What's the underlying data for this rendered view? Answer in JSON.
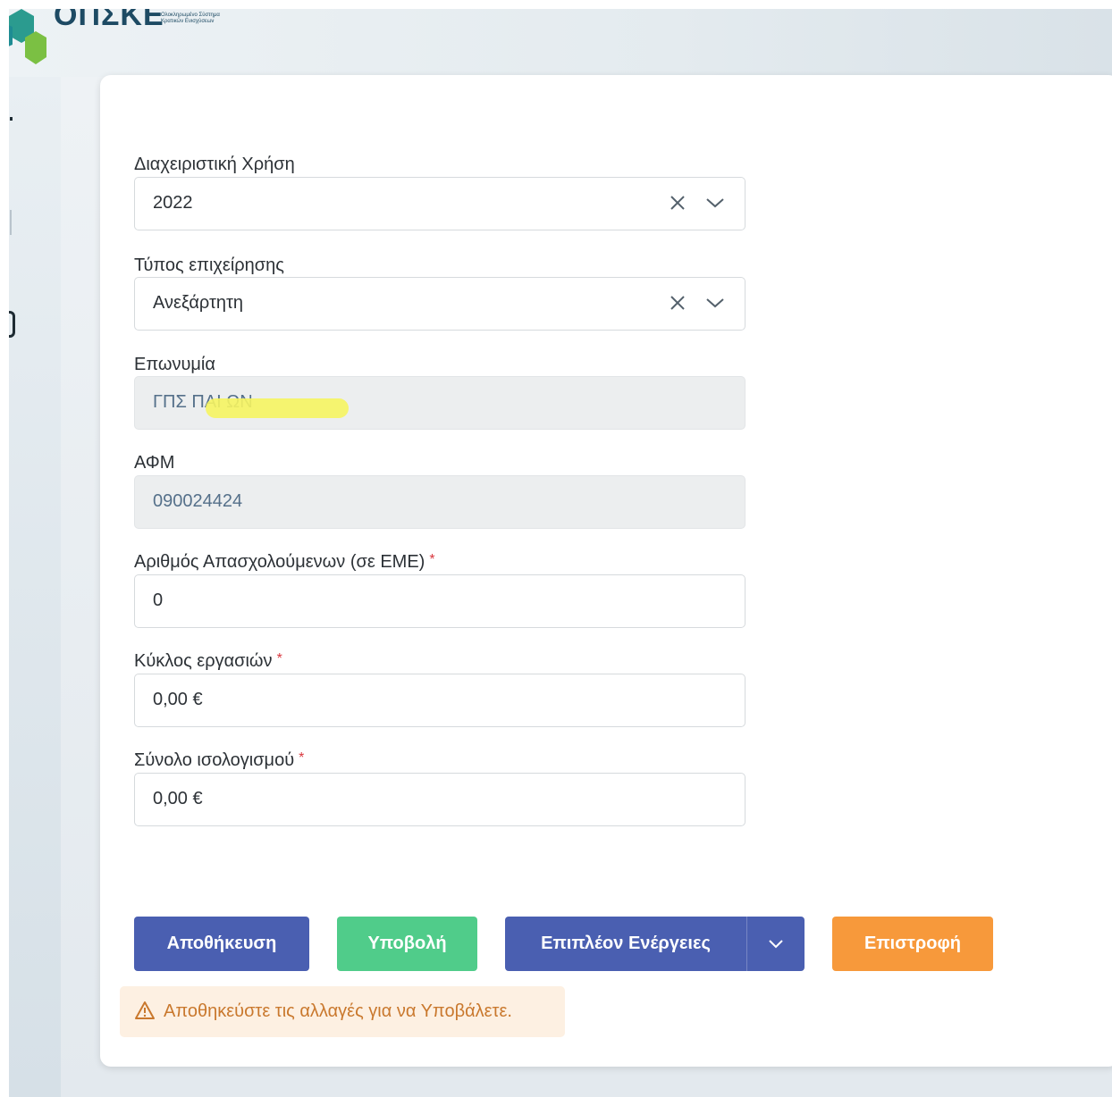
{
  "header": {
    "logo_text": "ΟΠΣΚΕ",
    "logo_subtitle_1": "Ολοκληρωμένο Σύστημα",
    "logo_subtitle_2": "Κρατικών Ενισχύσεων"
  },
  "form": {
    "fiscal_year": {
      "label": "Διαχειριστική Χρήση",
      "value": "2022"
    },
    "business_type": {
      "label": "Τύπος επιχείρησης",
      "value": "Ανεξάρτητη"
    },
    "company_name": {
      "label": "Επωνυμία",
      "value": "ΓΠΣ ΠΑΙ ΩΝ"
    },
    "tax_id": {
      "label": "ΑΦΜ",
      "value": "090024424"
    },
    "employees": {
      "label": "Αριθμός Απασχολούμενων (σε ΕΜΕ)",
      "required_mark": "*",
      "value": "0"
    },
    "turnover": {
      "label": "Κύκλος εργασιών",
      "required_mark": "*",
      "value": "0,00 €"
    },
    "balance_sheet": {
      "label": "Σύνολο ισολογισμού",
      "required_mark": "*",
      "value": "0,00 €"
    }
  },
  "actions": {
    "save_label": "Αποθήκευση",
    "submit_label": "Υποβολή",
    "more_actions_label": "Επιπλέον Ενέργειες",
    "back_label": "Επιστροφή"
  },
  "warning": {
    "text": "Αποθηκεύστε τις αλλαγές για να Υποβάλετε."
  },
  "colors": {
    "primary": "#4a5fb1",
    "success": "#50cc8a",
    "warning_button": "#f7993b",
    "warning_bg": "#fdf0e2",
    "warning_text": "#c9782d",
    "required": "#d9383f"
  }
}
